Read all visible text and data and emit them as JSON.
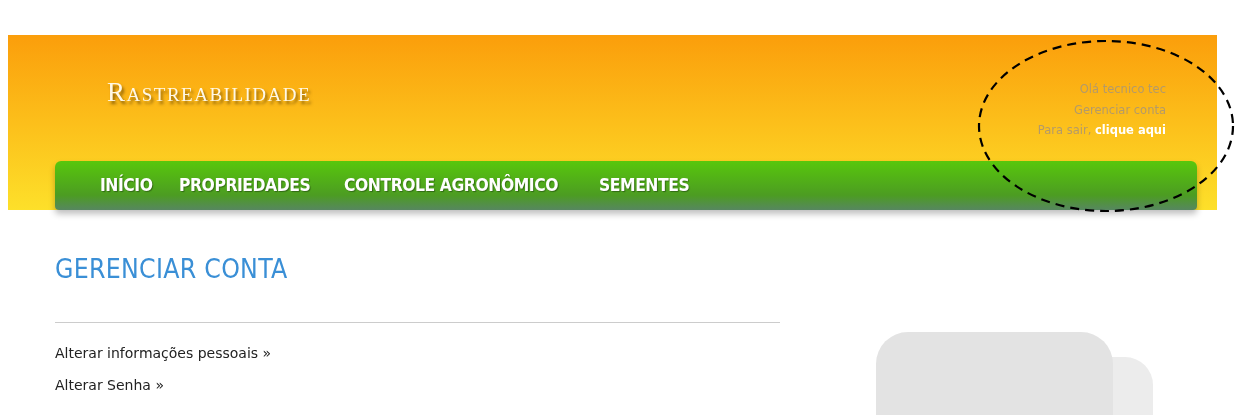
{
  "header": {
    "title": "Rastreabilidade",
    "user": {
      "greeting": "Olá tecnico tec",
      "account_link": "Gerenciar conta",
      "logout_prefix": "Para sair,",
      "logout_link": "clique aqui"
    }
  },
  "nav": [
    {
      "label": "INÍCIO"
    },
    {
      "label": "PROPRIEDADES"
    },
    {
      "label": "CONTROLE AGRONÔMICO"
    },
    {
      "label": "SEMENTES"
    }
  ],
  "page": {
    "heading": "GERENCIAR CONTA",
    "links": [
      "Alterar informações pessoais »",
      "Alterar Senha »"
    ]
  }
}
